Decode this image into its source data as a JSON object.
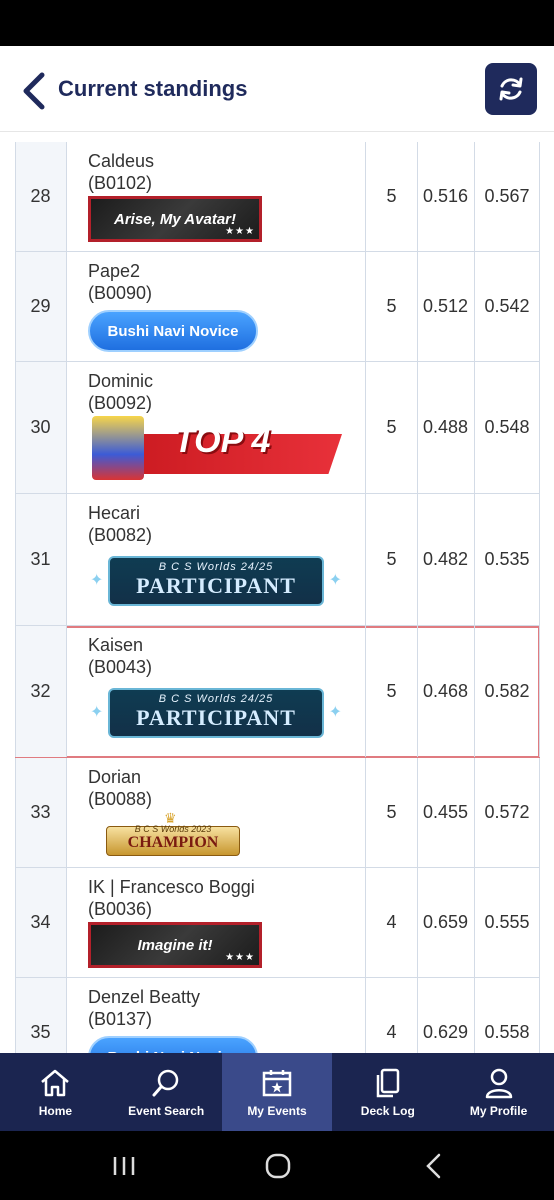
{
  "header": {
    "title": "Current standings"
  },
  "rows": [
    {
      "rank": "28",
      "name": "Caldeus",
      "id": "(B0102)",
      "badge": "dark",
      "badge_text": "Arise, My Avatar!",
      "points": "5",
      "omw": "0.516",
      "gw": "0.567"
    },
    {
      "rank": "29",
      "name": "Pape2",
      "id": "(B0090)",
      "badge": "blue",
      "badge_text": "Bushi Navi Novice",
      "points": "5",
      "omw": "0.512",
      "gw": "0.542"
    },
    {
      "rank": "30",
      "name": "Dominic",
      "id": "(B0092)",
      "badge": "top4",
      "badge_text": "TOP 4",
      "points": "5",
      "omw": "0.488",
      "gw": "0.548"
    },
    {
      "rank": "31",
      "name": "Hecari",
      "id": "(B0082)",
      "badge": "part",
      "badge_sub": "B C S Worlds 24/25",
      "badge_text": "PARTICIPANT",
      "points": "5",
      "omw": "0.482",
      "gw": "0.535"
    },
    {
      "rank": "32",
      "name": "Kaisen",
      "id": "(B0043)",
      "badge": "part",
      "badge_sub": "B C S Worlds 24/25",
      "badge_text": "PARTICIPANT",
      "points": "5",
      "omw": "0.468",
      "gw": "0.582",
      "highlight": true
    },
    {
      "rank": "33",
      "name": "Dorian",
      "id": "(B0088)",
      "badge": "champ",
      "badge_sub": "B C S Worlds 2023",
      "badge_text": "CHAMPION",
      "points": "5",
      "omw": "0.455",
      "gw": "0.572"
    },
    {
      "rank": "34",
      "name": "IK | Francesco Boggi",
      "id": "(B0036)",
      "badge": "dark",
      "badge_text": "Imagine it!",
      "points": "4",
      "omw": "0.659",
      "gw": "0.555"
    },
    {
      "rank": "35",
      "name": "Denzel Beatty",
      "id": "(B0137)",
      "badge": "blue",
      "badge_text": "Bushi Navi Novice",
      "points": "4",
      "omw": "0.629",
      "gw": "0.558"
    }
  ],
  "nav": [
    {
      "label": "Home",
      "icon": "home-icon"
    },
    {
      "label": "Event Search",
      "icon": "search-icon"
    },
    {
      "label": "My Events",
      "icon": "calendar-star-icon",
      "active": true
    },
    {
      "label": "Deck Log",
      "icon": "cards-icon"
    },
    {
      "label": "My Profile",
      "icon": "user-icon"
    }
  ],
  "colors": {
    "navy": "#1f2a5c",
    "nav_bg": "#1b2550",
    "nav_active": "#3a4a8a",
    "highlight_border": "#e07b80"
  }
}
